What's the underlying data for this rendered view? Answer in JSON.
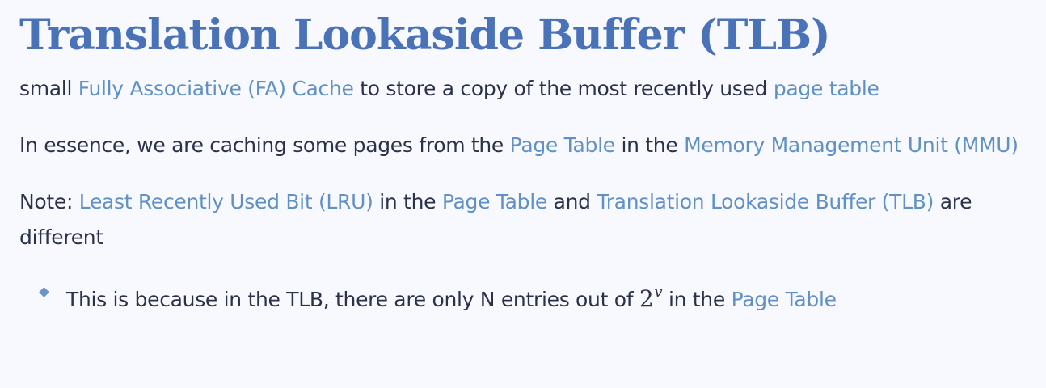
{
  "title": "Translation Lookaside Buffer (TLB)",
  "p1": {
    "t1": "small ",
    "link1": "Fully Associative (FA) Cache",
    "t2": " to store a copy of the most recently used ",
    "link2": "page table"
  },
  "p2": {
    "t1": "In essence, we are caching some pages from the ",
    "link1": "Page Table",
    "t2": " in the ",
    "link2": "Memory Management Unit (MMU)"
  },
  "p3": {
    "t1": "Note: ",
    "link1": "Least Recently Used Bit (LRU)",
    "t2": " in the ",
    "link2": "Page Table",
    "t3": " and ",
    "link3": "Translation Lookaside Buffer (TLB)",
    "t4": " are different"
  },
  "bullet1": {
    "t1": "This is because in the TLB, there are only N entries out of ",
    "math_base": "2",
    "math_exp": "v",
    "t2": " in the ",
    "link1": "Page Table"
  }
}
